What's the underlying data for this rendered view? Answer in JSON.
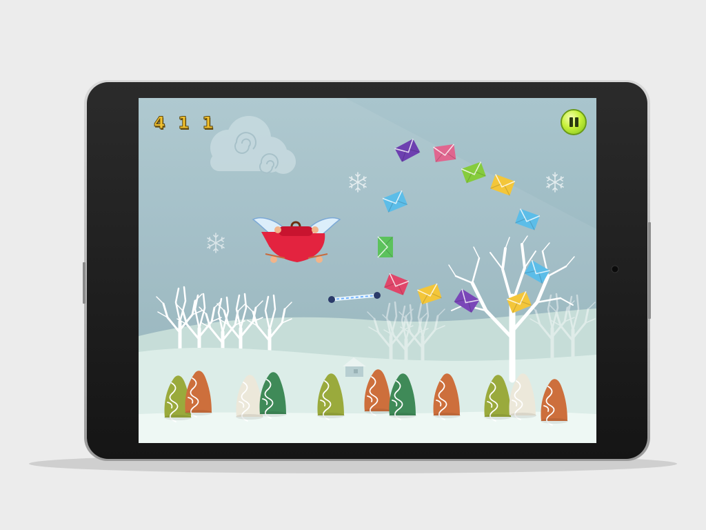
{
  "game": {
    "score": "4 1 1",
    "pause_icon": "pause-icon"
  },
  "colors": {
    "sky_upper": "#a8c4cc",
    "sky_lower": "#88a9b3",
    "snow": "#e2f1ec",
    "tablet_frame": "#1e1e1e",
    "envelope_colors": [
      "#6d40b0",
      "#e0668f",
      "#86cc3c",
      "#f3c63a",
      "#5cbde8",
      "#5cc25c",
      "#e0466a"
    ],
    "cone_colors": [
      "#cd6f3c",
      "#9aaa3c",
      "#3f8a58",
      "#ece8da"
    ]
  },
  "envelopes": [
    {
      "color": "#6d40b0",
      "tilt": -28
    },
    {
      "color": "#e0668f",
      "tilt": -8
    },
    {
      "color": "#86cc3c",
      "tilt": -20
    },
    {
      "color": "#f3c63a",
      "tilt": 20
    },
    {
      "color": "#5cbde8",
      "tilt": -22
    },
    {
      "color": "#5cbde8",
      "tilt": 20
    },
    {
      "color": "#5cc25c",
      "tilt": -90
    },
    {
      "color": "#5cbde8",
      "tilt": 30
    },
    {
      "color": "#e0466a",
      "tilt": 22
    },
    {
      "color": "#f3c63a",
      "tilt": -18
    },
    {
      "color": "#7a47b8",
      "tilt": 32
    },
    {
      "color": "#f3c63a",
      "tilt": -22
    }
  ]
}
